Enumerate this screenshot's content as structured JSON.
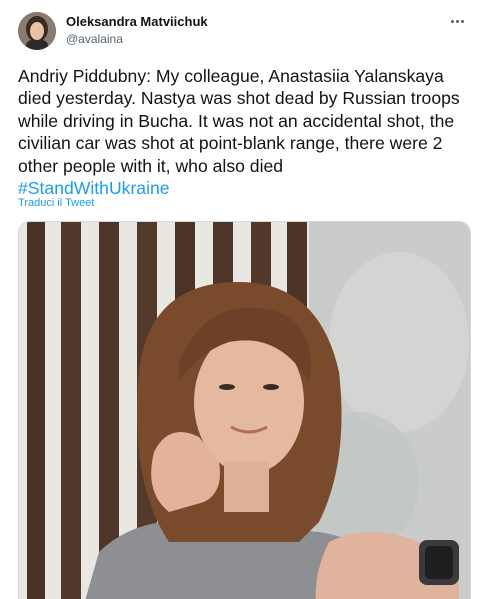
{
  "tweet": {
    "author_name": "Oleksandra Matviichuk",
    "author_handle": "@avalaina",
    "text": "Andriy Piddubny: My colleague, Anastasiia Yalanskaya died yesterday. Nastya was shot dead by Russian troops while driving in Bucha. It was not an accidental shot, the civilian car was shot at point-blank range, there were 2 other people with it, who also died",
    "hashtag": "#StandWithUkraine",
    "translate_label": "Traduci il Tweet",
    "more_icon": "more-horizontal-icon"
  },
  "colors": {
    "accent": "#1d9bf0",
    "text": "#0f1419",
    "secondary": "#536471"
  }
}
